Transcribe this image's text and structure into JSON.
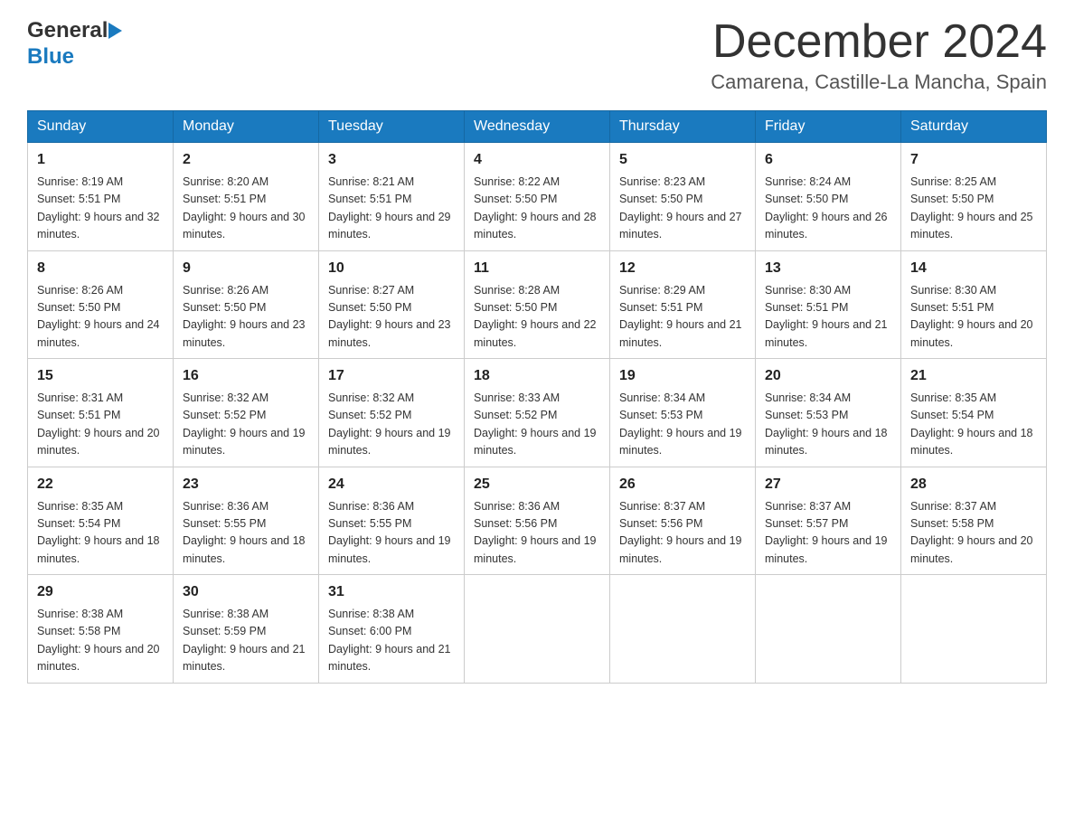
{
  "header": {
    "logo_general": "General",
    "logo_blue": "Blue",
    "month_title": "December 2024",
    "location": "Camarena, Castille-La Mancha, Spain"
  },
  "days_of_week": [
    "Sunday",
    "Monday",
    "Tuesday",
    "Wednesday",
    "Thursday",
    "Friday",
    "Saturday"
  ],
  "weeks": [
    [
      {
        "day": "1",
        "sunrise": "8:19 AM",
        "sunset": "5:51 PM",
        "daylight": "9 hours and 32 minutes."
      },
      {
        "day": "2",
        "sunrise": "8:20 AM",
        "sunset": "5:51 PM",
        "daylight": "9 hours and 30 minutes."
      },
      {
        "day": "3",
        "sunrise": "8:21 AM",
        "sunset": "5:51 PM",
        "daylight": "9 hours and 29 minutes."
      },
      {
        "day": "4",
        "sunrise": "8:22 AM",
        "sunset": "5:50 PM",
        "daylight": "9 hours and 28 minutes."
      },
      {
        "day": "5",
        "sunrise": "8:23 AM",
        "sunset": "5:50 PM",
        "daylight": "9 hours and 27 minutes."
      },
      {
        "day": "6",
        "sunrise": "8:24 AM",
        "sunset": "5:50 PM",
        "daylight": "9 hours and 26 minutes."
      },
      {
        "day": "7",
        "sunrise": "8:25 AM",
        "sunset": "5:50 PM",
        "daylight": "9 hours and 25 minutes."
      }
    ],
    [
      {
        "day": "8",
        "sunrise": "8:26 AM",
        "sunset": "5:50 PM",
        "daylight": "9 hours and 24 minutes."
      },
      {
        "day": "9",
        "sunrise": "8:26 AM",
        "sunset": "5:50 PM",
        "daylight": "9 hours and 23 minutes."
      },
      {
        "day": "10",
        "sunrise": "8:27 AM",
        "sunset": "5:50 PM",
        "daylight": "9 hours and 23 minutes."
      },
      {
        "day": "11",
        "sunrise": "8:28 AM",
        "sunset": "5:50 PM",
        "daylight": "9 hours and 22 minutes."
      },
      {
        "day": "12",
        "sunrise": "8:29 AM",
        "sunset": "5:51 PM",
        "daylight": "9 hours and 21 minutes."
      },
      {
        "day": "13",
        "sunrise": "8:30 AM",
        "sunset": "5:51 PM",
        "daylight": "9 hours and 21 minutes."
      },
      {
        "day": "14",
        "sunrise": "8:30 AM",
        "sunset": "5:51 PM",
        "daylight": "9 hours and 20 minutes."
      }
    ],
    [
      {
        "day": "15",
        "sunrise": "8:31 AM",
        "sunset": "5:51 PM",
        "daylight": "9 hours and 20 minutes."
      },
      {
        "day": "16",
        "sunrise": "8:32 AM",
        "sunset": "5:52 PM",
        "daylight": "9 hours and 19 minutes."
      },
      {
        "day": "17",
        "sunrise": "8:32 AM",
        "sunset": "5:52 PM",
        "daylight": "9 hours and 19 minutes."
      },
      {
        "day": "18",
        "sunrise": "8:33 AM",
        "sunset": "5:52 PM",
        "daylight": "9 hours and 19 minutes."
      },
      {
        "day": "19",
        "sunrise": "8:34 AM",
        "sunset": "5:53 PM",
        "daylight": "9 hours and 19 minutes."
      },
      {
        "day": "20",
        "sunrise": "8:34 AM",
        "sunset": "5:53 PM",
        "daylight": "9 hours and 18 minutes."
      },
      {
        "day": "21",
        "sunrise": "8:35 AM",
        "sunset": "5:54 PM",
        "daylight": "9 hours and 18 minutes."
      }
    ],
    [
      {
        "day": "22",
        "sunrise": "8:35 AM",
        "sunset": "5:54 PM",
        "daylight": "9 hours and 18 minutes."
      },
      {
        "day": "23",
        "sunrise": "8:36 AM",
        "sunset": "5:55 PM",
        "daylight": "9 hours and 18 minutes."
      },
      {
        "day": "24",
        "sunrise": "8:36 AM",
        "sunset": "5:55 PM",
        "daylight": "9 hours and 19 minutes."
      },
      {
        "day": "25",
        "sunrise": "8:36 AM",
        "sunset": "5:56 PM",
        "daylight": "9 hours and 19 minutes."
      },
      {
        "day": "26",
        "sunrise": "8:37 AM",
        "sunset": "5:56 PM",
        "daylight": "9 hours and 19 minutes."
      },
      {
        "day": "27",
        "sunrise": "8:37 AM",
        "sunset": "5:57 PM",
        "daylight": "9 hours and 19 minutes."
      },
      {
        "day": "28",
        "sunrise": "8:37 AM",
        "sunset": "5:58 PM",
        "daylight": "9 hours and 20 minutes."
      }
    ],
    [
      {
        "day": "29",
        "sunrise": "8:38 AM",
        "sunset": "5:58 PM",
        "daylight": "9 hours and 20 minutes."
      },
      {
        "day": "30",
        "sunrise": "8:38 AM",
        "sunset": "5:59 PM",
        "daylight": "9 hours and 21 minutes."
      },
      {
        "day": "31",
        "sunrise": "8:38 AM",
        "sunset": "6:00 PM",
        "daylight": "9 hours and 21 minutes."
      },
      null,
      null,
      null,
      null
    ]
  ]
}
